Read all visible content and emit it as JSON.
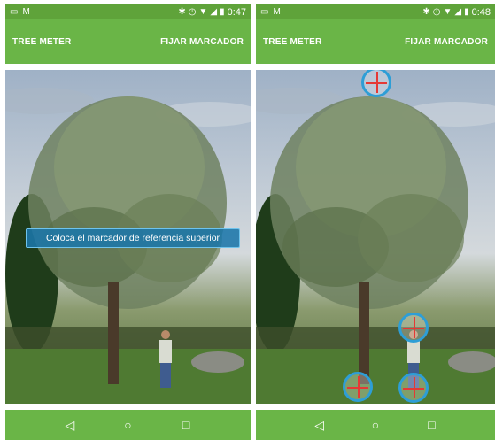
{
  "screens": [
    {
      "status": {
        "time": "0:47",
        "left_icons": [
          "image-icon",
          "gmail-icon"
        ],
        "right_icons": [
          "bluetooth-icon",
          "alarm-icon",
          "wifi-icon",
          "signal-icon",
          "battery-icon"
        ]
      },
      "appbar": {
        "title": "TREE METER",
        "action": "FIJAR MARCADOR"
      },
      "hint": "Coloca el marcador de referencia superior",
      "nav": [
        "back-icon",
        "home-icon",
        "recents-icon"
      ]
    },
    {
      "status": {
        "time": "0:48",
        "left_icons": [
          "image-icon",
          "gmail-icon"
        ],
        "right_icons": [
          "bluetooth-icon",
          "alarm-icon",
          "wifi-icon",
          "signal-icon",
          "battery-icon"
        ]
      },
      "appbar": {
        "title": "TREE METER",
        "action": "FIJAR MARCADOR"
      },
      "markers": [
        "tree-top-marker",
        "person-top-marker",
        "person-base-marker",
        "tree-base-marker"
      ],
      "nav": [
        "back-icon",
        "home-icon",
        "recents-icon"
      ]
    }
  ],
  "colors": {
    "status_bar": "#5fa33a",
    "app_bar": "#6ab547",
    "marker_ring": "#2e9ed6",
    "marker_cross": "#e53935"
  }
}
